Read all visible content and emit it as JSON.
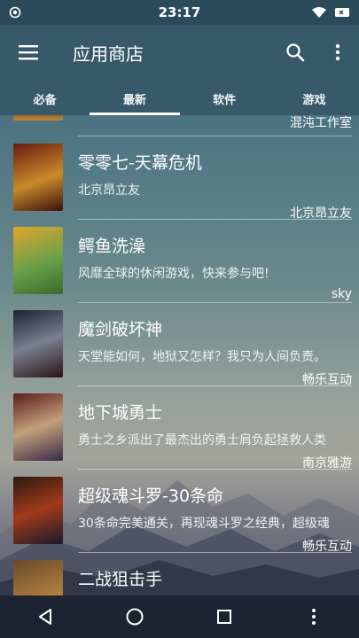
{
  "status_bar": {
    "time": "23:17"
  },
  "app_bar": {
    "title": "应用商店"
  },
  "tabs": [
    {
      "label": "必备",
      "active": false
    },
    {
      "label": "最新",
      "active": true
    },
    {
      "label": "软件",
      "active": false
    },
    {
      "label": "游戏",
      "active": false
    }
  ],
  "list": {
    "partial_top_developer": "混沌工作室",
    "items": [
      {
        "name": "零零七-天幕危机",
        "description": "北京昂立友",
        "developer": "北京昂立友",
        "thumb_colors": [
          "#6a1a10",
          "#c88a2a"
        ]
      },
      {
        "name": "鳄鱼洗澡",
        "description": "风靡全球的休闲游戏，快来参与吧!",
        "developer": "sky",
        "thumb_colors": [
          "#e0a62a",
          "#4d8a3a"
        ]
      },
      {
        "name": "魔剑破坏神",
        "description": "天堂能如何，地狱又怎样？我只为人间负责。",
        "developer": "畅乐互动",
        "thumb_colors": [
          "#1d2230",
          "#7a8090"
        ]
      },
      {
        "name": "地下城勇士",
        "description": "勇士之乡派出了最杰出的勇士肩负起拯救人类",
        "developer": "南京雅游",
        "thumb_colors": [
          "#5a1d1a",
          "#c2a07a"
        ]
      },
      {
        "name": "超级魂斗罗-30条命",
        "description": "30条命完美通关，再现魂斗罗之经典，超级魂",
        "developer": "畅乐互动",
        "thumb_colors": [
          "#2a1a10",
          "#a23a1a"
        ]
      },
      {
        "name": "二战狙击手",
        "description": "",
        "developer": "",
        "thumb_colors": [
          "#6a4a2a",
          "#b08040"
        ]
      }
    ]
  },
  "icons": {
    "status_left": "circle-dot-icon",
    "status_wifi": "wifi-icon",
    "status_battery": "battery-icon",
    "menu": "hamburger-menu-icon",
    "search": "search-icon",
    "overflow": "more-vertical-icon",
    "nav_back": "back-triangle-icon",
    "nav_home": "home-circle-icon",
    "nav_recents": "recents-square-icon"
  }
}
